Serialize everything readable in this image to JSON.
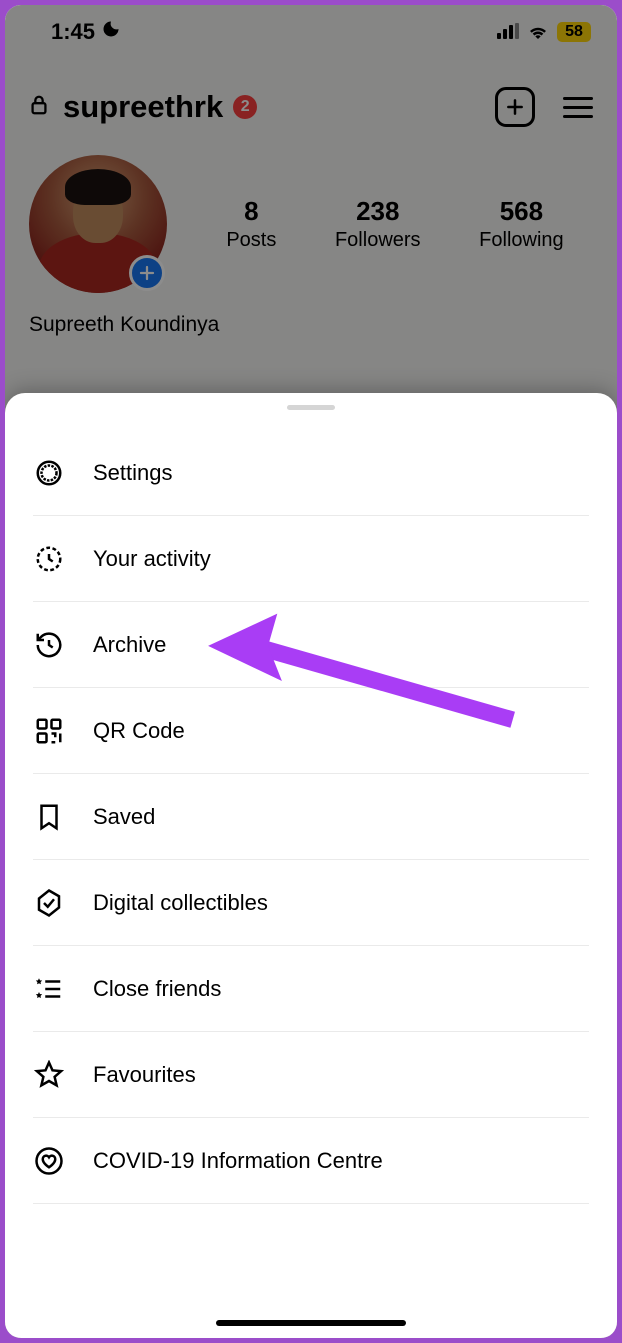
{
  "status": {
    "time": "1:45",
    "battery": "58"
  },
  "profile": {
    "username": "supreethrk",
    "badge": "2",
    "display_name": "Supreeth Koundinya",
    "stats": {
      "posts": {
        "count": "8",
        "label": "Posts"
      },
      "followers": {
        "count": "238",
        "label": "Followers"
      },
      "following": {
        "count": "568",
        "label": "Following"
      }
    }
  },
  "menu": {
    "settings": "Settings",
    "activity": "Your activity",
    "archive": "Archive",
    "qr": "QR Code",
    "saved": "Saved",
    "collectibles": "Digital collectibles",
    "close_friends": "Close friends",
    "favourites": "Favourites",
    "covid": "COVID-19 Information Centre"
  }
}
